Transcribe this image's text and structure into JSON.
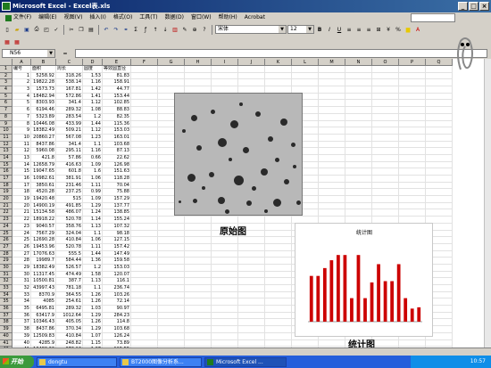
{
  "window": {
    "title": "Microsoft Excel - Excel表.xls",
    "buttons": [
      "_",
      "□",
      "×"
    ]
  },
  "menu": {
    "items": [
      "文件(F)",
      "编辑(E)",
      "视图(V)",
      "插入(I)",
      "格式(O)",
      "工具(T)",
      "数据(D)",
      "窗口(W)",
      "帮助(H)",
      "Acrobat"
    ]
  },
  "toolbar": {
    "font_name": "宋体",
    "font_size": "12",
    "icons": [
      "new",
      "open",
      "save",
      "print",
      "preview",
      "spell",
      "cut",
      "copy",
      "paste",
      "undo",
      "redo",
      "hyperlink",
      "autosum",
      "function",
      "sort-asc",
      "sort-desc",
      "chart-wizard",
      "drawing",
      "zoom",
      "help"
    ],
    "format_icons": [
      "bold",
      "italic",
      "underline",
      "align-left",
      "align-center",
      "align-right",
      "merge",
      "currency",
      "percent",
      "comma",
      "fill-color",
      "font-color"
    ]
  },
  "formula": {
    "cell_ref": "N56",
    "fx": "="
  },
  "columns": [
    "A",
    "B",
    "C",
    "D",
    "E",
    "F",
    "G",
    "H",
    "I",
    "J",
    "K",
    "L",
    "M",
    "N",
    "O",
    "P",
    "Q"
  ],
  "headers": [
    "编号",
    "面积",
    "周长",
    "圆度",
    "等效圆直径"
  ],
  "rows": [
    [
      "1",
      "5258.92",
      "318.26",
      "1.53",
      "81.83"
    ],
    [
      "2",
      "19822.28",
      "538.14",
      "1.16",
      "158.91"
    ],
    [
      "3",
      "1573.73",
      "167.81",
      "1.42",
      "44.77"
    ],
    [
      "4",
      "18482.94",
      "572.86",
      "1.41",
      "153.44"
    ],
    [
      "5",
      "8303.93",
      "341.4",
      "1.12",
      "102.85"
    ],
    [
      "6",
      "6194.46",
      "289.32",
      "1.08",
      "88.83"
    ],
    [
      "7",
      "5323.89",
      "283.54",
      "1.2",
      "82.35"
    ],
    [
      "8",
      "10446.08",
      "433.99",
      "1.44",
      "115.36"
    ],
    [
      "9",
      "18382.49",
      "509.21",
      "1.12",
      "153.03"
    ],
    [
      "10",
      "20860.27",
      "567.08",
      "1.23",
      "163.01"
    ],
    [
      "11",
      "8437.86",
      "341.4",
      "1.1",
      "103.68"
    ],
    [
      "12",
      "5960.08",
      "295.11",
      "1.16",
      "87.13"
    ],
    [
      "13",
      "421.8",
      "57.86",
      "0.66",
      "22.62"
    ],
    [
      "14",
      "12658.79",
      "416.63",
      "1.09",
      "126.98"
    ],
    [
      "15",
      "19047.65",
      "601.8",
      "1.6",
      "151.63"
    ],
    [
      "16",
      "10982.61",
      "381.91",
      "1.06",
      "118.28"
    ],
    [
      "17",
      "3850.61",
      "231.46",
      "1.11",
      "70.04"
    ],
    [
      "18",
      "4520.28",
      "237.25",
      "0.99",
      "75.88"
    ],
    [
      "19",
      "19420.48",
      "515",
      "1.09",
      "157.29"
    ],
    [
      "20",
      "14900.19",
      "491.85",
      "1.29",
      "137.77"
    ],
    [
      "21",
      "15134.58",
      "486.07",
      "1.24",
      "138.85"
    ],
    [
      "22",
      "18918.22",
      "520.78",
      "1.14",
      "155.24"
    ],
    [
      "23",
      "9040.57",
      "358.76",
      "1.13",
      "107.32"
    ],
    [
      "24",
      "7567.29",
      "324.04",
      "1.1",
      "98.18"
    ],
    [
      "25",
      "12690.28",
      "410.84",
      "1.06",
      "127.15"
    ],
    [
      "26",
      "19453.96",
      "520.78",
      "1.11",
      "157.42"
    ],
    [
      "27",
      "17076.63",
      "555.5",
      "1.44",
      "147.49"
    ],
    [
      "28",
      "19989.7",
      "584.44",
      "1.36",
      "159.58"
    ],
    [
      "29",
      "18382.49",
      "526.57",
      "1.2",
      "153.03"
    ],
    [
      "30",
      "11317.45",
      "474.49",
      "1.58",
      "120.07"
    ],
    [
      "31",
      "10500.81",
      "387.7",
      "1.13",
      "116.1"
    ],
    [
      "32",
      "43997.43",
      "781.18",
      "1.1",
      "236.74"
    ],
    [
      "33",
      "8370.9",
      "364.55",
      "1.26",
      "103.26"
    ],
    [
      "34",
      "4085",
      "254.61",
      "1.26",
      "72.14"
    ],
    [
      "35",
      "6495.81",
      "289.32",
      "1.03",
      "90.97"
    ],
    [
      "36",
      "63417.9",
      "1012.64",
      "1.29",
      "284.23"
    ],
    [
      "37",
      "10346.43",
      "405.05",
      "1.26",
      "114.8"
    ],
    [
      "38",
      "8437.86",
      "370.34",
      "1.29",
      "103.68"
    ],
    [
      "39",
      "12509.83",
      "410.84",
      "1.07",
      "126.24"
    ],
    [
      "40",
      "4285.9",
      "248.82",
      "1.15",
      "73.89"
    ],
    [
      "41",
      "10480.36",
      "376.12",
      "1.07",
      "115.55"
    ]
  ],
  "labels": {
    "original_image": "原始图",
    "chart_caption": "统计图"
  },
  "chart_data": {
    "type": "bar",
    "title": "统计图",
    "bar_color": "#cc0000",
    "values": [
      3.5,
      3.5,
      4.1,
      4.7,
      5.1,
      5.1,
      1.8,
      5.1,
      1.8,
      3,
      4.4,
      3.1,
      3.1,
      4.4,
      1.8,
      1,
      1.1
    ]
  },
  "taskbar": {
    "start": "开始",
    "tasks": [
      "dongtu",
      "BT2000图像分析系...",
      "Microsoft Excel ..."
    ],
    "clock": "10:57"
  }
}
